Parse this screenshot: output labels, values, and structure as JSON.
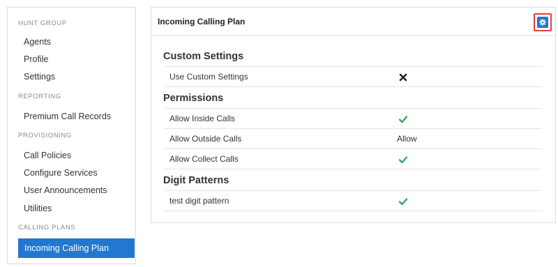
{
  "sidebar": {
    "sections": [
      {
        "header": "HUNT GROUP",
        "items": [
          "Agents",
          "Profile",
          "Settings"
        ]
      },
      {
        "header": "REPORTING",
        "items": [
          "Premium Call Records"
        ]
      },
      {
        "header": "PROVISIONING",
        "items": [
          "Call Policies",
          "Configure Services",
          "User Announcements",
          "Utilities"
        ]
      },
      {
        "header": "CALLING PLANS",
        "items": [
          "Incoming Calling Plan"
        ]
      }
    ],
    "active_item": "Incoming Calling Plan"
  },
  "panel": {
    "title": "Incoming Calling Plan",
    "settings_icon": "gear-icon",
    "groups": [
      {
        "title": "Custom Settings",
        "rows": [
          {
            "label": "Use Custom Settings",
            "value_type": "icon",
            "icon": "x-mark-icon",
            "value": ""
          }
        ]
      },
      {
        "title": "Permissions",
        "rows": [
          {
            "label": "Allow Inside Calls",
            "value_type": "icon",
            "icon": "check-icon",
            "value": ""
          },
          {
            "label": "Allow Outside Calls",
            "value_type": "text",
            "icon": "",
            "value": "Allow"
          },
          {
            "label": "Allow Collect Calls",
            "value_type": "icon",
            "icon": "check-icon",
            "value": ""
          }
        ]
      },
      {
        "title": "Digit Patterns",
        "rows": [
          {
            "label": "test digit pattern",
            "value_type": "icon",
            "icon": "check-icon",
            "value": ""
          }
        ]
      }
    ]
  },
  "colors": {
    "accent": "#2277d1",
    "check": "#2eaa5c",
    "highlight_frame": "#e0403a"
  }
}
